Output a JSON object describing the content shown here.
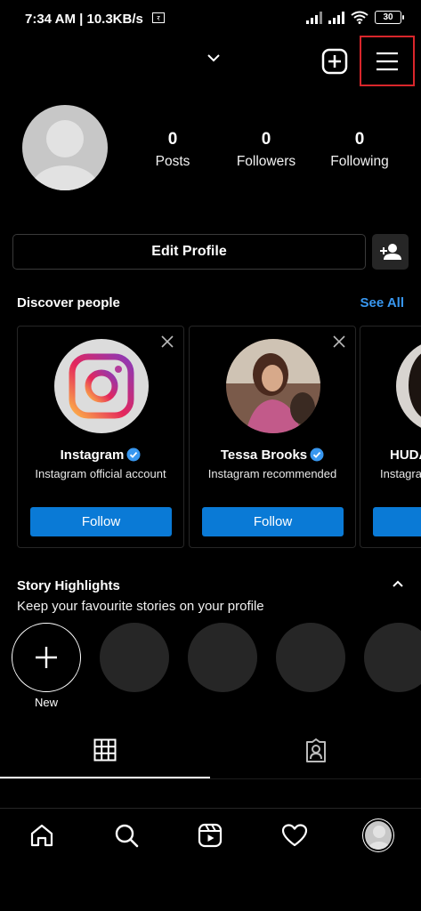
{
  "status_bar": {
    "time": "7:34 AM | 10.3KB/s",
    "battery": "30"
  },
  "header": {
    "username_dropdown_icon": "chevron-down-icon",
    "new_post_icon": "plus-square-icon",
    "menu_icon": "hamburger-menu-icon"
  },
  "profile": {
    "stats": [
      {
        "value": "0",
        "label": "Posts"
      },
      {
        "value": "0",
        "label": "Followers"
      },
      {
        "value": "0",
        "label": "Following"
      }
    ],
    "edit_profile_label": "Edit Profile"
  },
  "discover": {
    "title": "Discover people",
    "see_all": "See All",
    "cards": [
      {
        "name": "Instagram",
        "subtitle": "Instagram official account",
        "button": "Follow",
        "verified": true
      },
      {
        "name": "Tessa Brooks",
        "subtitle": "Instagram recommended",
        "button": "Follow",
        "verified": true
      },
      {
        "name": "HUDA",
        "subtitle": "Instagra",
        "button": "",
        "verified": false
      }
    ]
  },
  "highlights": {
    "title": "Story Highlights",
    "subtitle": "Keep your favourite stories on your profile",
    "new_label": "New"
  },
  "colors": {
    "accent": "#0a7ad6",
    "link": "#3897f0",
    "highlight_box": "#d9262b",
    "background": "#000000"
  }
}
